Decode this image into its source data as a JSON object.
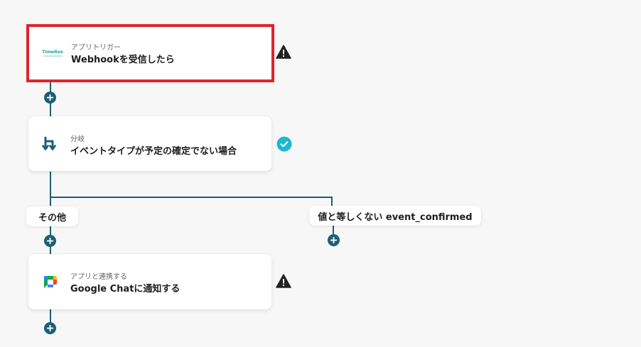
{
  "flow": {
    "trigger": {
      "subtitle": "アプリトリガー",
      "title": "Webhookを受信したら",
      "logo_text": "TimeRex",
      "status": "warning"
    },
    "branch": {
      "subtitle": "分岐",
      "title": "イベントタイプが予定の確定でない場合",
      "status": "complete"
    },
    "branch_labels": {
      "left": "その他",
      "right": "値と等しくない event_confirmed"
    },
    "action": {
      "subtitle": "アプリと連携する",
      "title": "Google Chatに通知する",
      "status": "warning"
    }
  },
  "colors": {
    "line": "#1c5f74",
    "selection": "#e0242e",
    "check": "#1fb8cc",
    "warning": "#222222"
  },
  "icons": {
    "trigger": "timerex-logo",
    "branch": "branch-icon",
    "action": "google-chat-icon",
    "add": "plus-icon",
    "warning": "warning-icon",
    "complete": "check-circle-icon"
  }
}
